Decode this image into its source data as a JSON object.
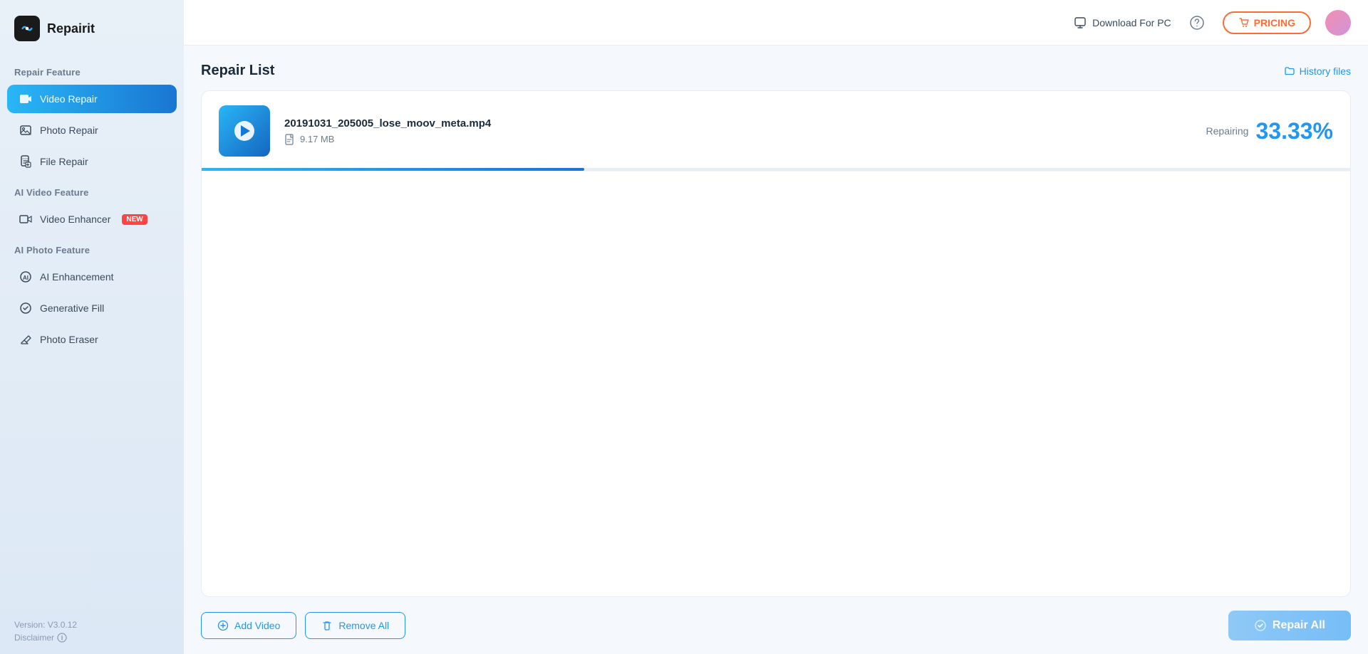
{
  "app": {
    "name": "Repairit"
  },
  "sidebar": {
    "repair_feature_label": "Repair Feature",
    "video_repair_label": "Video Repair",
    "photo_repair_label": "Photo Repair",
    "file_repair_label": "File Repair",
    "ai_video_feature_label": "AI Video Feature",
    "video_enhancer_label": "Video Enhancer",
    "video_enhancer_badge": "NEW",
    "ai_photo_feature_label": "AI Photo Feature",
    "ai_enhancement_label": "AI Enhancement",
    "generative_fill_label": "Generative Fill",
    "photo_eraser_label": "Photo Eraser",
    "version": "Version: V3.0.12",
    "disclaimer": "Disclaimer"
  },
  "header": {
    "download_label": "Download For PC",
    "pricing_label": "PRICING"
  },
  "main": {
    "page_title": "Repair List",
    "history_files_label": "History files"
  },
  "repair_item": {
    "file_name": "20191031_205005_lose_moov_meta.mp4",
    "file_size": "9.17 MB",
    "status_label": "Repairing",
    "percent": "33.33%",
    "progress": 33.33
  },
  "bottom_bar": {
    "add_video_label": "Add Video",
    "remove_all_label": "Remove All",
    "repair_all_label": "Repair All"
  }
}
